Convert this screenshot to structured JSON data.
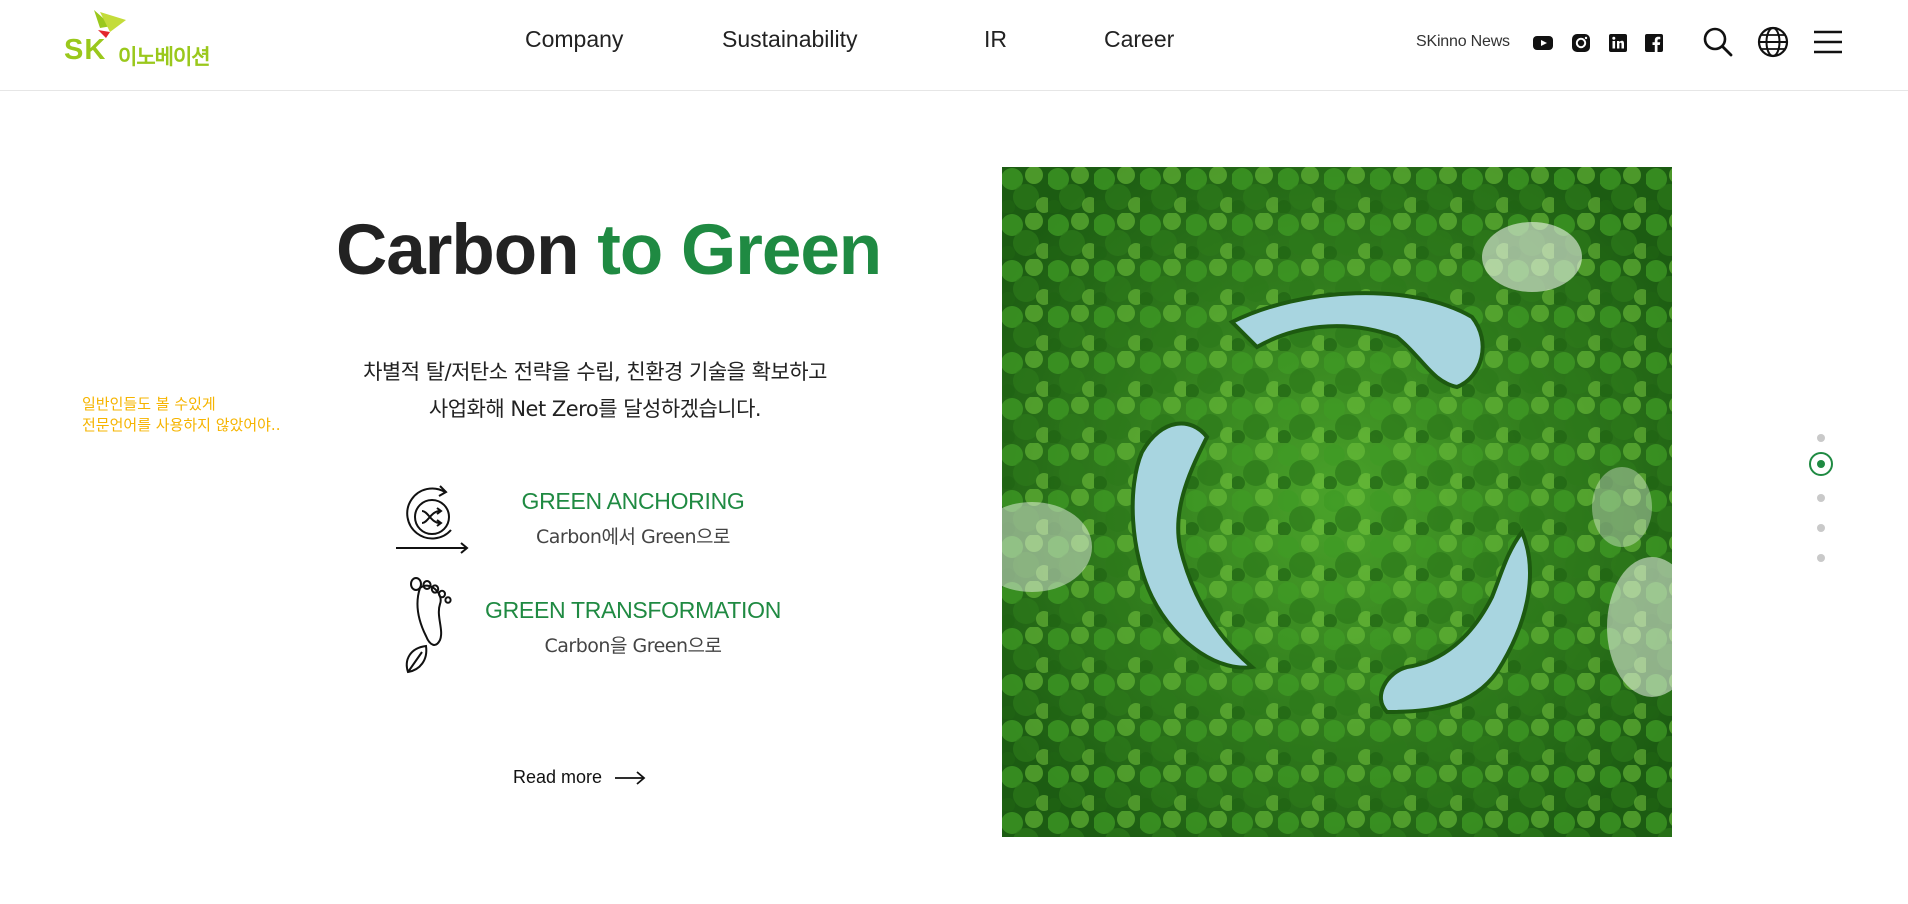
{
  "header": {
    "logo": {
      "brand": "SK",
      "name": "이노베이션"
    },
    "nav": [
      "Company",
      "Sustainability",
      "IR",
      "Career"
    ],
    "news_link": "SKinno News",
    "social": [
      "youtube-icon",
      "instagram-icon",
      "linkedin-icon",
      "facebook-icon"
    ],
    "utilities": [
      "search-icon",
      "globe-icon",
      "hamburger-menu-icon"
    ]
  },
  "hero": {
    "headline_dark": "Carbon",
    "headline_green": "to Green",
    "description_line1": "차별적 탈/저탄소 전략을 수립, 친환경 기술을 확보하고",
    "description_line2": "사업화해 Net Zero를 달성하겠습니다.",
    "features": [
      {
        "icon": "shuffle-cycle-icon",
        "title": "GREEN ANCHORING",
        "subtitle": "Carbon에서 Green으로"
      },
      {
        "icon": "footprint-leaf-icon",
        "title": "GREEN TRANSFORMATION",
        "subtitle": "Carbon을 Green으로"
      }
    ],
    "read_more": "Read more"
  },
  "annotation_note": {
    "line1": "일반인들도 볼 수있게",
    "line2": "전문언어를 사용하지 않았어야.."
  },
  "pagination": {
    "total": 5,
    "active_index": 1
  },
  "colors": {
    "brand_green": "#1f8a42",
    "logo_lime": "#9ac81c",
    "note_yellow": "#f6b400"
  }
}
